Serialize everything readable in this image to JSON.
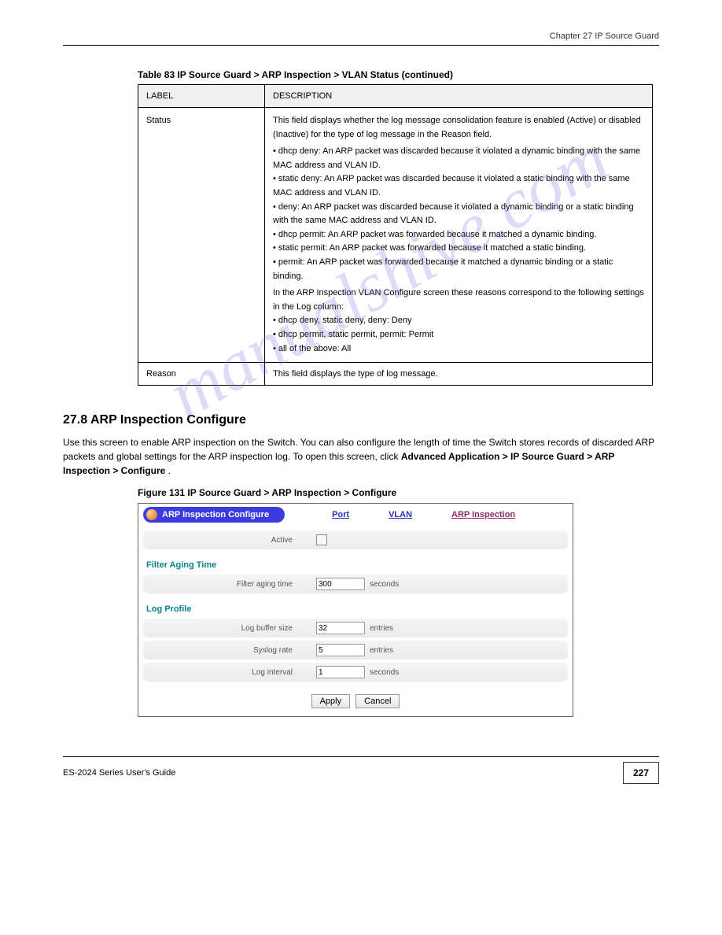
{
  "header": {
    "chapter": "Chapter 27 IP Source Guard"
  },
  "watermark": "manualshive.com",
  "table": {
    "caption": "Table 83   IP Source Guard > ARP Inspection > VLAN Status (continued)",
    "headers": [
      "LABEL",
      "DESCRIPTION"
    ],
    "rows": [
      {
        "label": "Status",
        "desc_lines": [
          "This field displays whether the log message consolidation feature is enabled (Active) or disabled (Inactive) for the type of log message in the Reason field.",
          "• dhcp deny: An ARP packet was discarded because it violated a dynamic binding with the same MAC address and VLAN ID.",
          "• static deny: An ARP packet was discarded because it violated a static binding with the same MAC address and VLAN ID.",
          "• deny: An ARP packet was discarded because it violated a dynamic binding or a static binding with the same MAC address and VLAN ID.",
          "• dhcp permit: An ARP packet was forwarded because it matched a dynamic binding.",
          "• static permit: An ARP packet was forwarded because it matched a static binding.",
          "• permit: An ARP packet was forwarded because it matched a dynamic binding or a static binding.",
          "In the ARP Inspection VLAN Configure screen these reasons correspond to the following settings in the Log column:",
          "• dhcp deny, static deny, deny: Deny",
          "• dhcp permit, static permit, permit: Permit",
          "• all of the above: All"
        ]
      },
      {
        "label": "Reason",
        "desc_lines": [
          "This field displays the type of log message."
        ]
      }
    ]
  },
  "section": {
    "heading": "27.8  ARP Inspection Configure",
    "para1_prefix": "Use this screen to enable ARP inspection on the Switch. You can also configure the length of time the Switch stores records of discarded ARP packets and global settings for the ARP inspection log. To open this screen, click ",
    "para1_bold": "Advanced Application > IP Source Guard > ARP Inspection > Configure",
    "para1_suffix": "."
  },
  "figure": {
    "caption": "Figure 131   IP Source Guard > ARP Inspection > Configure",
    "title": "ARP Inspection Configure",
    "links": {
      "port": "Port",
      "vlan": "VLAN",
      "arp": "ARP Inspection"
    },
    "active_label": "Active",
    "filter_section": "Filter Aging Time",
    "filter_label": "Filter aging time",
    "filter_value": "300",
    "filter_unit": "seconds",
    "log_section": "Log Profile",
    "log_buffer_label": "Log buffer size",
    "log_buffer_value": "32",
    "log_buffer_unit": "entries",
    "syslog_label": "Syslog rate",
    "syslog_value": "5",
    "syslog_unit": "entries",
    "interval_label": "Log interval",
    "interval_value": "1",
    "interval_unit": "seconds",
    "apply": "Apply",
    "cancel": "Cancel"
  },
  "footer": {
    "left": "ES-2024 Series User's Guide",
    "page": "227"
  }
}
